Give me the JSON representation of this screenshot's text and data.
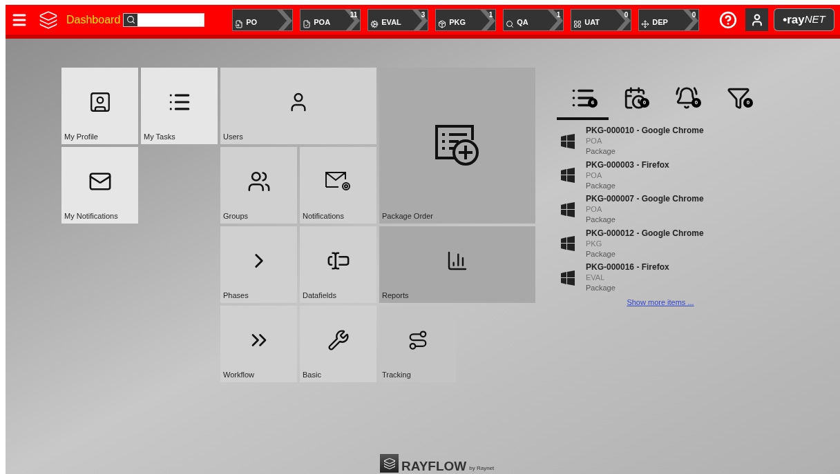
{
  "header": {
    "title": "Dashboard",
    "stages": [
      {
        "label": "PO"
      },
      {
        "label": "POA",
        "count": "11"
      },
      {
        "label": "EVAL",
        "count": "3"
      },
      {
        "label": "PKG",
        "count": "1"
      },
      {
        "label": "QA",
        "count": "1"
      },
      {
        "label": "UAT",
        "count": "0"
      },
      {
        "label": "DEP",
        "count": "0"
      }
    ],
    "logo_main": "•ray",
    "logo_sub": "NET"
  },
  "tiles": [
    {
      "label": "My Profile"
    },
    {
      "label": "My Tasks"
    },
    {
      "label": "Users"
    },
    {
      "label": "My Notifications"
    },
    {
      "label": "Groups"
    },
    {
      "label": "Notifications"
    },
    {
      "label": "Package Order"
    },
    {
      "label": "Phases"
    },
    {
      "label": "Datafields"
    },
    {
      "label": "Reports"
    },
    {
      "label": "Workflow"
    },
    {
      "label": "Basic"
    },
    {
      "label": "Tracking"
    }
  ],
  "panel": {
    "tabs": [
      {
        "count": "6",
        "selected": true
      },
      {
        "count": "0",
        "selected": false
      },
      {
        "count": "0",
        "selected": false
      },
      {
        "count": "0",
        "selected": false
      }
    ],
    "items": [
      {
        "title": "PKG-000010 - Google Chrome",
        "phase": "POA",
        "type": "Package"
      },
      {
        "title": "PKG-000003 - Firefox",
        "phase": "POA",
        "type": "Package"
      },
      {
        "title": "PKG-000007 - Google Chrome",
        "phase": "POA",
        "type": "Package"
      },
      {
        "title": "PKG-000012 - Google Chrome",
        "phase": "PKG",
        "type": "Package"
      },
      {
        "title": "PKG-000016 - Firefox",
        "phase": "EVAL",
        "type": "Package"
      }
    ],
    "more_link": "Show more items ..."
  },
  "footer": {
    "brand": "RAYFLOW",
    "by": "by Raynet"
  }
}
